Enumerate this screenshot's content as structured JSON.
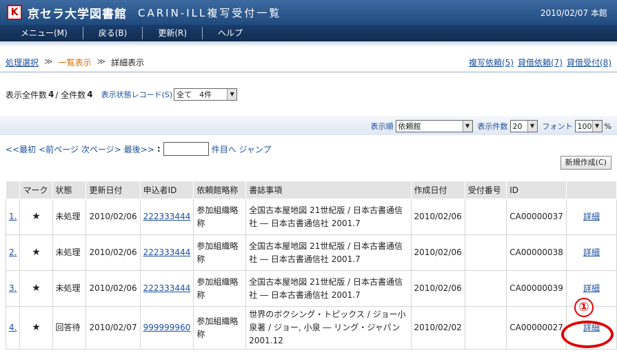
{
  "header": {
    "logo_glyph": "K",
    "title": "京セラ大学図書館",
    "subtitle": "CARIN-ILL複写受付一覧",
    "right_info": "2010/02/07 本館"
  },
  "menu": [
    {
      "label": "メニュー(M)"
    },
    {
      "label": "戻る(B)"
    },
    {
      "label": "更新(R)"
    },
    {
      "label": "ヘルプ"
    }
  ],
  "breadcrumb": {
    "step1": "処理選択",
    "sep": "≫",
    "step2": "一覧表示",
    "step3": "詳細表示"
  },
  "top_links": [
    "複写依頼(5)",
    "貸借依頼(7)",
    "貸借受付(8)"
  ],
  "counts": {
    "label_all": "表示全件数",
    "display_count": "4",
    "slash": " / 全件数",
    "total_count": "4",
    "record_label": "表示状態レコード(S)",
    "record_select": "全て　4件"
  },
  "options": {
    "order_label": "表示順",
    "order_value": "依頼館",
    "per_page_label": "表示件数",
    "per_page_value": "20",
    "font_label": "フォント",
    "font_value": "100",
    "font_unit": "%"
  },
  "pager": {
    "first": "<<最初",
    "prev": "<前ページ",
    "next": "次ページ>",
    "last": "最後>>",
    "colon": ":",
    "jump_label": "件目へ ジャンプ",
    "jump_value": ""
  },
  "new_button": "新規作成(C)",
  "table": {
    "headers": [
      "",
      "マーク",
      "状態",
      "更新日付",
      "申込者ID",
      "依頼館略称",
      "書誌事項",
      "作成日付",
      "受付番号",
      "ID",
      ""
    ],
    "rows": [
      {
        "num": "1.",
        "mark": "★",
        "status": "未処理",
        "updated": "2010/02/06",
        "applicant": "222333444",
        "lib": "参加組織略称",
        "biblio": "全国古本屋地図 21世紀版 / 日本古書通信社 ― 日本古書通信社 2001.7",
        "created": "2010/02/06",
        "receipt": "",
        "id": "CA00000037",
        "detail": "詳細"
      },
      {
        "num": "2.",
        "mark": "★",
        "status": "未処理",
        "updated": "2010/02/06",
        "applicant": "222333444",
        "lib": "参加組織略称",
        "biblio": "全国古本屋地図 21世紀版 / 日本古書通信社 ― 日本古書通信社 2001.7",
        "created": "2010/02/06",
        "receipt": "",
        "id": "CA00000038",
        "detail": "詳細"
      },
      {
        "num": "3.",
        "mark": "★",
        "status": "未処理",
        "updated": "2010/02/06",
        "applicant": "222333444",
        "lib": "参加組織略称",
        "biblio": "全国古本屋地図 21世紀版 / 日本古書通信社 ― 日本古書通信社 2001.7",
        "created": "2010/02/06",
        "receipt": "",
        "id": "CA00000039",
        "detail": "詳細"
      },
      {
        "num": "4.",
        "mark": "★",
        "status": "回答待",
        "updated": "2010/02/07",
        "applicant": "999999960",
        "lib": "参加組織略称",
        "biblio": "世界のボクシング・トピックス / ジョー小泉著 / ジョー, 小泉 ― リング・ジャパン 2001.12",
        "created": "2010/02/02",
        "receipt": "",
        "id": "CA00000027",
        "detail": "詳細"
      }
    ]
  },
  "annotation": {
    "number": "①"
  }
}
